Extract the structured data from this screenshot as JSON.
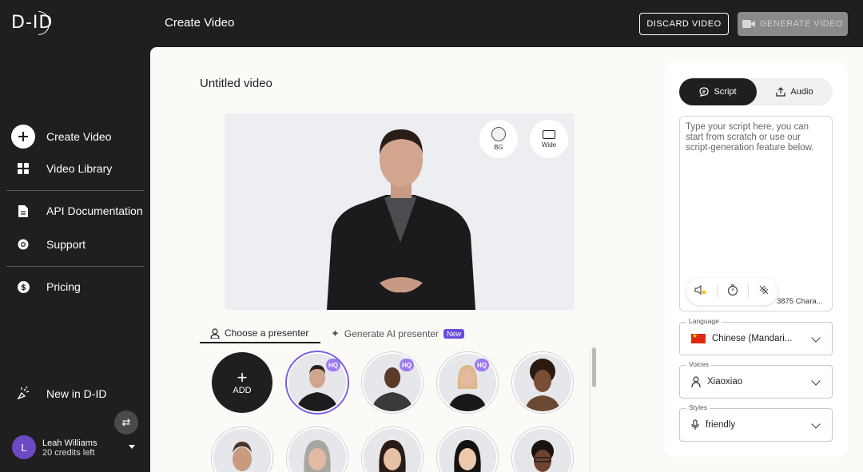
{
  "header": {
    "logo": "D-ID",
    "title": "Create Video",
    "discard_label": "DISCARD VIDEO",
    "generate_label": "GENERATE VIDEO"
  },
  "sidebar": {
    "items": [
      {
        "label": "Create Video",
        "icon": "plus-circle-icon"
      },
      {
        "label": "Video Library",
        "icon": "grid-icon"
      },
      {
        "label": "API Documentation",
        "icon": "document-icon"
      },
      {
        "label": "Support",
        "icon": "lifebuoy-icon"
      },
      {
        "label": "Pricing",
        "icon": "dollar-icon"
      },
      {
        "label": "New in D-ID",
        "icon": "sparkle-hand-icon"
      }
    ],
    "user": {
      "initial": "L",
      "name": "Leah Williams",
      "credits": "20 credits left"
    }
  },
  "main": {
    "video_title": "Untitled video",
    "stage_buttons": {
      "bg": "BG",
      "wide": "Wide"
    },
    "tabs": {
      "choose": "Choose a presenter",
      "generate": "Generate AI presenter",
      "new_badge": "New"
    },
    "add_label": "ADD",
    "hq_label": "HQ"
  },
  "panel": {
    "mode_script": "Script",
    "mode_audio": "Audio",
    "script_placeholder": "Type your script here, you can start from scratch or use our script-generation feature below.",
    "char_count": "3875 Chara...",
    "language_label": "Language",
    "language_value": "Chinese (Mandari...",
    "voices_label": "Voices",
    "voices_value": "Xiaoxiao",
    "styles_label": "Styles",
    "styles_value": "friendly"
  },
  "colors": {
    "dark": "#1f1f1f",
    "accent": "#6b4bdb",
    "hq_badge": "#9b7bf0"
  }
}
